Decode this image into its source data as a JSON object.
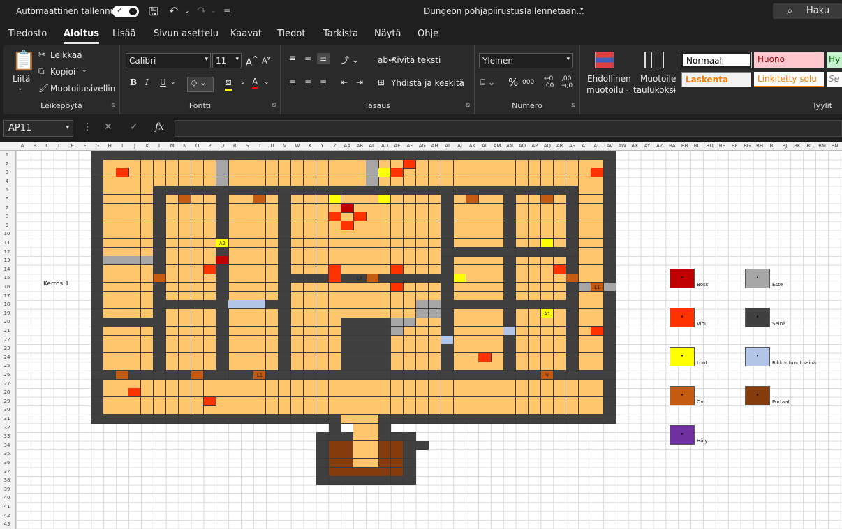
{
  "titlebar": {
    "autosave": "Automaattinen tallennus",
    "title": "Dungeon pohjapiirustus",
    "status": "Tallennetaan...",
    "search": "Haku"
  },
  "tabs": [
    "Tiedosto",
    "Aloitus",
    "Lisää",
    "Sivun asettelu",
    "Kaavat",
    "Tiedot",
    "Tarkista",
    "Näytä",
    "Ohje"
  ],
  "ribbon": {
    "clipboard": {
      "paste": "Liitä",
      "cut": "Leikkaa",
      "copy": "Kopioi",
      "painter": "Muotoilusivellin",
      "label": "Leikepöytä"
    },
    "font": {
      "name": "Calibri",
      "size": "11",
      "label": "Fontti"
    },
    "alignment": {
      "wrap": "Rivitä teksti",
      "merge": "Yhdistä ja keskitä",
      "label": "Tasaus"
    },
    "number": {
      "format": "Yleinen",
      "label": "Numero"
    },
    "conditional": {
      "line1": "Ehdollinen",
      "line2": "muotoilu"
    },
    "table": {
      "line1": "Muotoile",
      "line2": "taulukoksi"
    },
    "styles": {
      "normal": "Normaali",
      "bad": "Huono",
      "good": "Hy",
      "calc": "Laskenta",
      "linked": "Linkitetty solu",
      "expl": "Se",
      "label": "Tyylit"
    }
  },
  "formula_bar": {
    "cell": "AP11"
  },
  "sheet": {
    "floor_label": "Kerros 1",
    "cell_labels": {
      "a2": "A2",
      "lx": "LX",
      "l1a": "L1",
      "a1": "A1",
      "l1b": "L1",
      "v": "V"
    },
    "legend": [
      {
        "label": "Bossi",
        "color": "#c00000"
      },
      {
        "label": "Este",
        "color": "#a6a6a6"
      },
      {
        "label": "Vihu",
        "color": "#ff3300"
      },
      {
        "label": "Seinä",
        "color": "#404040"
      },
      {
        "label": "Loot",
        "color": "#ffff00"
      },
      {
        "label": "Rikkoutunut seinä",
        "color": "#b4c6e7"
      },
      {
        "label": "Ovi",
        "color": "#c55a11"
      },
      {
        "label": "Portaat",
        "color": "#843c0c"
      },
      {
        "label": "Häly",
        "color": "#7030a0"
      }
    ]
  }
}
